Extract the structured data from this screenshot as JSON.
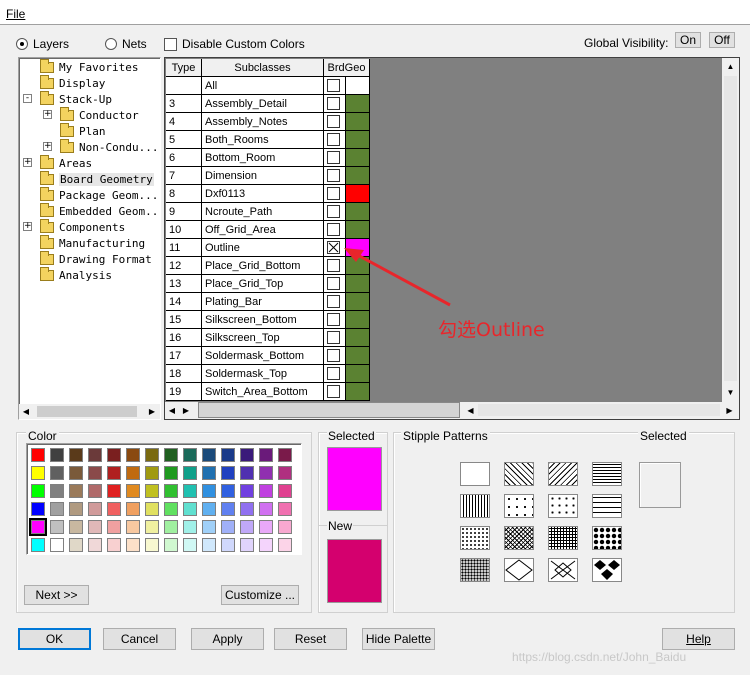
{
  "menu": {
    "file": "File"
  },
  "top": {
    "layers": "Layers",
    "nets": "Nets",
    "disable_custom": "Disable Custom Colors",
    "global_visibility": "Global Visibility:",
    "on": "On",
    "off": "Off"
  },
  "tree": [
    {
      "label": "My Favorites",
      "level": 1,
      "expander": ""
    },
    {
      "label": "Display",
      "level": 1,
      "expander": ""
    },
    {
      "label": "Stack-Up",
      "level": 1,
      "expander": "-"
    },
    {
      "label": "Conductor",
      "level": 2,
      "expander": "+"
    },
    {
      "label": "Plan",
      "level": 2,
      "expander": ""
    },
    {
      "label": "Non-Condu...",
      "level": 2,
      "expander": "+"
    },
    {
      "label": "Areas",
      "level": 1,
      "expander": "+"
    },
    {
      "label": "Board Geometry",
      "level": 1,
      "expander": "",
      "selected": true
    },
    {
      "label": "Package Geom...",
      "level": 1,
      "expander": ""
    },
    {
      "label": "Embedded Geom...",
      "level": 1,
      "expander": ""
    },
    {
      "label": "Components",
      "level": 1,
      "expander": "+"
    },
    {
      "label": "Manufacturing",
      "level": 1,
      "expander": ""
    },
    {
      "label": "Drawing Format",
      "level": 1,
      "expander": ""
    },
    {
      "label": "Analysis",
      "level": 1,
      "expander": ""
    }
  ],
  "grid": {
    "headers": {
      "type": "Type",
      "subclasses": "Subclasses",
      "brdgeo": "BrdGeo"
    },
    "all_label": "All",
    "rows": [
      {
        "type": "3",
        "name": "Assembly_Detail",
        "checked": false,
        "color": "#5b8232"
      },
      {
        "type": "4",
        "name": "Assembly_Notes",
        "checked": false,
        "color": "#5b8232"
      },
      {
        "type": "5",
        "name": "Both_Rooms",
        "checked": false,
        "color": "#5b8232"
      },
      {
        "type": "6",
        "name": "Bottom_Room",
        "checked": false,
        "color": "#5b8232"
      },
      {
        "type": "7",
        "name": "Dimension",
        "checked": false,
        "color": "#5b8232"
      },
      {
        "type": "8",
        "name": "Dxf0113",
        "checked": false,
        "color": "#ff0000"
      },
      {
        "type": "9",
        "name": "Ncroute_Path",
        "checked": false,
        "color": "#5b8232"
      },
      {
        "type": "10",
        "name": "Off_Grid_Area",
        "checked": false,
        "color": "#5b8232"
      },
      {
        "type": "11",
        "name": "Outline",
        "checked": true,
        "color": "#ff00ff"
      },
      {
        "type": "12",
        "name": "Place_Grid_Bottom",
        "checked": false,
        "color": "#5b8232"
      },
      {
        "type": "13",
        "name": "Place_Grid_Top",
        "checked": false,
        "color": "#5b8232"
      },
      {
        "type": "14",
        "name": "Plating_Bar",
        "checked": false,
        "color": "#5b8232"
      },
      {
        "type": "15",
        "name": "Silkscreen_Bottom",
        "checked": false,
        "color": "#5b8232"
      },
      {
        "type": "16",
        "name": "Silkscreen_Top",
        "checked": false,
        "color": "#5b8232"
      },
      {
        "type": "17",
        "name": "Soldermask_Bottom",
        "checked": false,
        "color": "#5b8232"
      },
      {
        "type": "18",
        "name": "Soldermask_Top",
        "checked": false,
        "color": "#5b8232"
      },
      {
        "type": "19",
        "name": "Switch_Area_Bottom",
        "checked": false,
        "color": "#5b8232"
      }
    ]
  },
  "annotation": {
    "text": "勾选Outline",
    "color": "#e8262b"
  },
  "color_panel": {
    "title": "Color",
    "next": "Next >>",
    "customize": "Customize ...",
    "palette": [
      [
        "#ff0000",
        "#404040",
        "#5a3a1a",
        "#6b3a3a",
        "#7a1f1f",
        "#8a4a10",
        "#7a6a10",
        "#206020",
        "#1a6a5a",
        "#1a4a7a",
        "#1a3a8a",
        "#3a1a7a",
        "#6a1a7a",
        "#7a1a4a"
      ],
      [
        "#ffff00",
        "#606060",
        "#7a5a3a",
        "#8a4a4a",
        "#b02020",
        "#c06a10",
        "#a09a10",
        "#209a20",
        "#10a08a",
        "#2070b0",
        "#2040c0",
        "#5030b0",
        "#9030b0",
        "#b03080"
      ],
      [
        "#00ff00",
        "#808080",
        "#9a7a5a",
        "#b06a6a",
        "#e02020",
        "#e08a20",
        "#c0c020",
        "#30c030",
        "#20c0b0",
        "#3090e0",
        "#3060e0",
        "#7040e0",
        "#c040e0",
        "#e04090"
      ],
      [
        "#0000ff",
        "#a0a0a0",
        "#b09a80",
        "#d09a9a",
        "#f06060",
        "#f0a060",
        "#e0e060",
        "#60e060",
        "#60e0d0",
        "#60b0f0",
        "#6080f0",
        "#9070f0",
        "#d070f0",
        "#f070b0"
      ],
      [
        "#ff00ff",
        "#c0c0c0",
        "#c8b8a0",
        "#e0b8b8",
        "#f0a0a0",
        "#f8c8a0",
        "#f0f0a0",
        "#a0f0a0",
        "#a0f0e8",
        "#a0d0f8",
        "#a0b0f8",
        "#c0a8f8",
        "#e8a8f8",
        "#f8a8d0"
      ],
      [
        "#00ffff",
        "#ffffff",
        "#e0d8c8",
        "#f0d8d8",
        "#f8d0d0",
        "#fce0c8",
        "#f8f8d0",
        "#d0f8d0",
        "#d0f8f4",
        "#d0e8fc",
        "#d0d8fc",
        "#e0d4fc",
        "#f4d4fc",
        "#fcd4e8"
      ]
    ]
  },
  "selected_panel": {
    "selected": "Selected",
    "new": "New",
    "selected_color": "#ff00ff",
    "new_color": "#d4006e"
  },
  "stipple": {
    "title": "Stipple Patterns",
    "selected": "Selected"
  },
  "buttons": {
    "ok": "OK",
    "cancel": "Cancel",
    "apply": "Apply",
    "reset": "Reset",
    "hide_palette": "Hide Palette",
    "help": "Help"
  },
  "watermark": "https://blog.csdn.net/John_Baidu"
}
